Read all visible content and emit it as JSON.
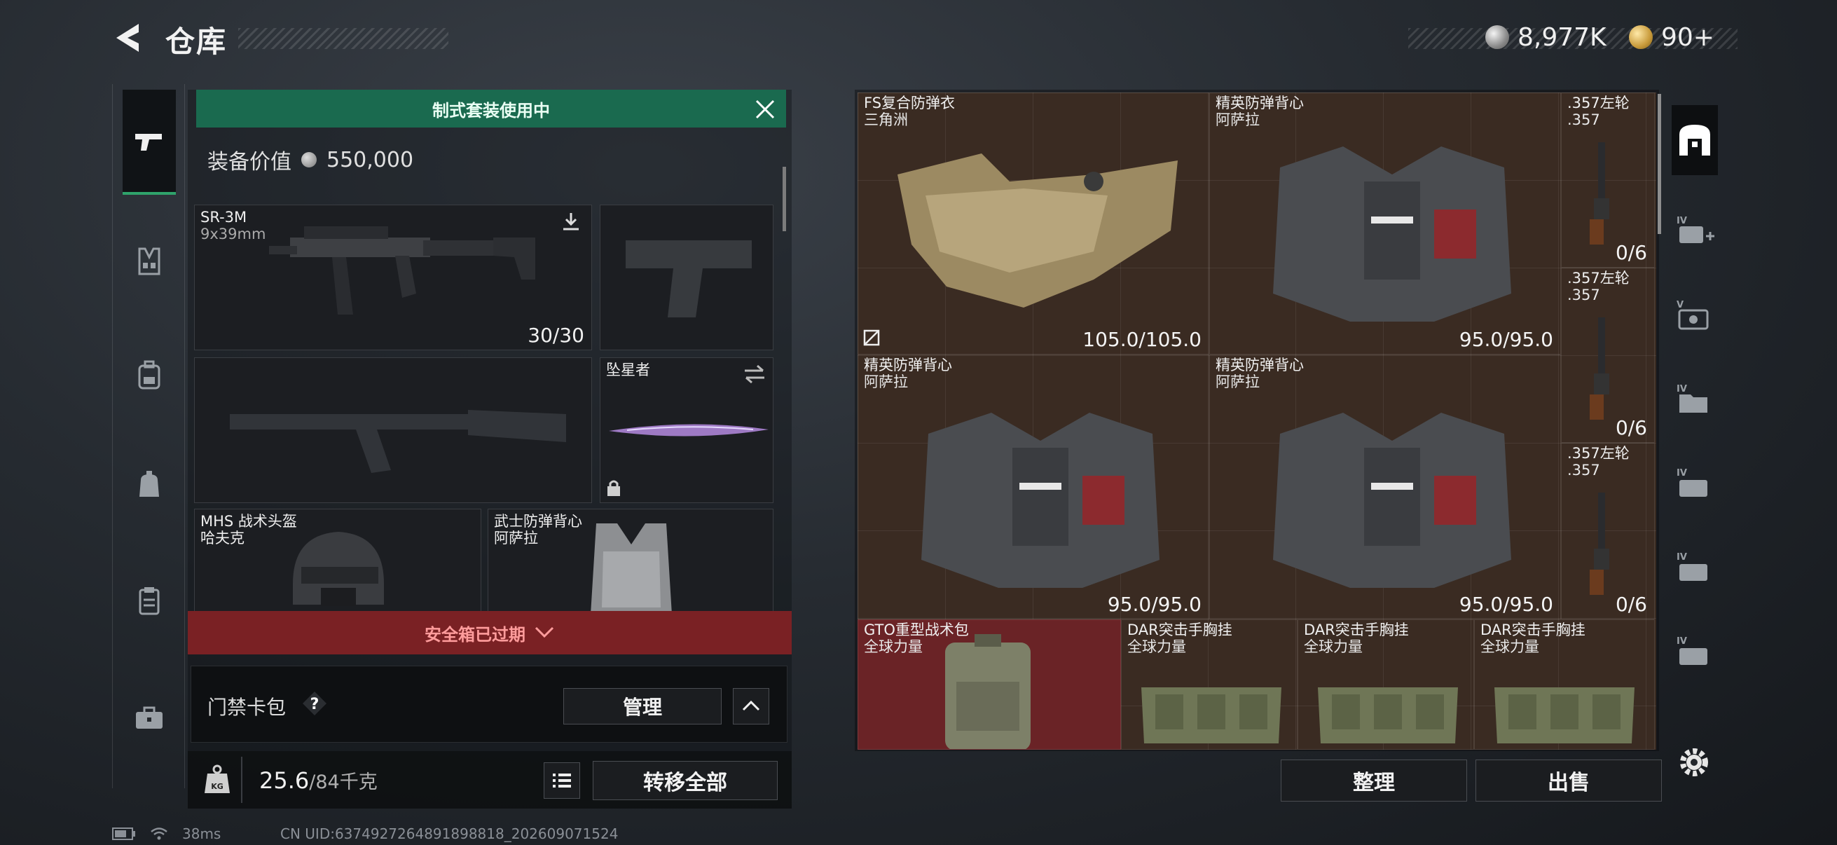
{
  "header": {
    "title": "仓库"
  },
  "currency": {
    "silver": "8,977K",
    "gold": "90+"
  },
  "loadout": {
    "set_banner": "制式套装使用中",
    "value_label": "装备价值",
    "value": "550,000",
    "primary": {
      "name": "SR-3M",
      "ammo_type": "9x39mm",
      "ammo": "30/30"
    },
    "melee": {
      "name": "坠星者"
    },
    "helmet": {
      "name": "MHS 战术头盔",
      "brand": "哈夫克"
    },
    "armor": {
      "name": "武士防弹背心",
      "brand": "阿萨拉"
    },
    "safe_box": "安全箱已过期",
    "access_card": "门禁卡包",
    "manage": "管理",
    "weight": "25.6",
    "weight_max": "/84千克",
    "transfer_all": "转移全部"
  },
  "stash": {
    "items": [
      {
        "name": "FS复合防弹衣",
        "brand": "三角洲",
        "durability": "105.0/105.0"
      },
      {
        "name": "精英防弹背心",
        "brand": "阿萨拉",
        "durability": "95.0/95.0"
      },
      {
        "name": ".357左轮",
        "brand": ".357",
        "count": "0/6"
      },
      {
        "name": ".357左轮",
        "brand": ".357",
        "count": "0/6"
      },
      {
        "name": "精英防弹背心",
        "brand": "阿萨拉",
        "durability": "95.0/95.0"
      },
      {
        "name": "精英防弹背心",
        "brand": "阿萨拉",
        "durability": "95.0/95.0"
      },
      {
        "name": ".357左轮",
        "brand": ".357",
        "count": "0/6"
      },
      {
        "name": "GTO重型战术包",
        "brand": "全球力量"
      },
      {
        "name": "DAR突击手胸挂",
        "brand": "全球力量"
      },
      {
        "name": "DAR突击手胸挂",
        "brand": "全球力量"
      },
      {
        "name": "DAR突击手胸挂",
        "brand": "全球力量"
      }
    ],
    "sort": "整理",
    "sell": "出售"
  },
  "status": {
    "ping": "38ms",
    "uid": "CN UID:6374927264891898818_202609071524"
  },
  "colors": {
    "accent_green": "#1a6a4f",
    "alert_red": "#7a2124",
    "stash_bg": "#3a2b22"
  }
}
